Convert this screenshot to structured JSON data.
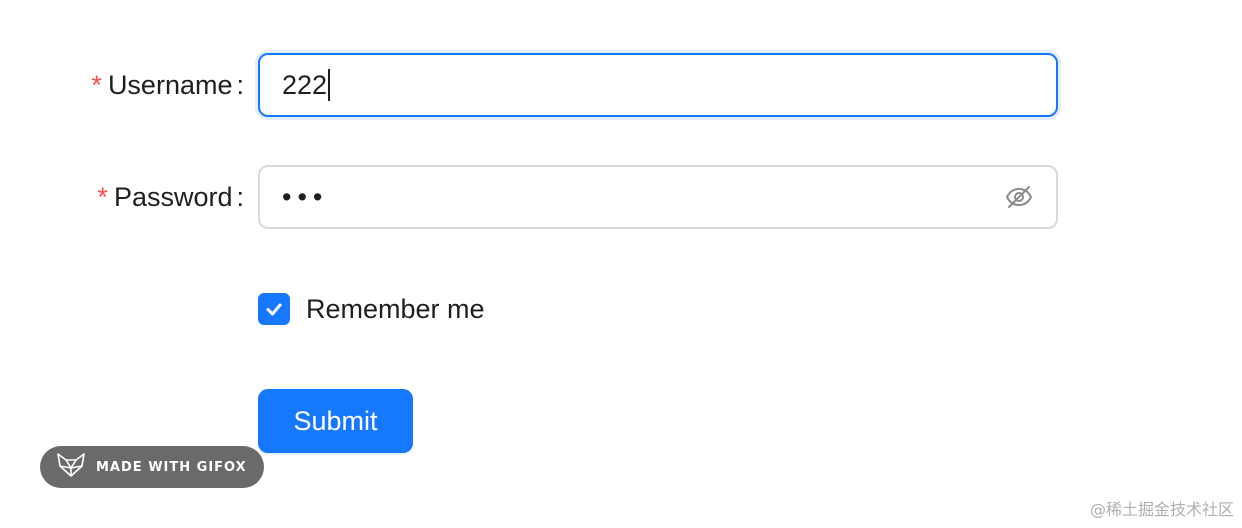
{
  "form": {
    "username": {
      "required_mark": "*",
      "label": "Username",
      "colon": ":",
      "value": "222"
    },
    "password": {
      "required_mark": "*",
      "label": "Password",
      "colon": ":",
      "masked_value": "•••",
      "toggle_icon": "eye-invisible-icon"
    },
    "remember": {
      "label": "Remember me",
      "checked": true
    },
    "submit_label": "Submit"
  },
  "colors": {
    "primary": "#1677ff",
    "required": "#ff4d4f",
    "border": "#d9d9d9"
  },
  "badge": {
    "text": "MADE WITH GIFOX",
    "icon": "fox-logo-icon"
  },
  "watermark": {
    "text": "@稀土掘金技术社区"
  }
}
